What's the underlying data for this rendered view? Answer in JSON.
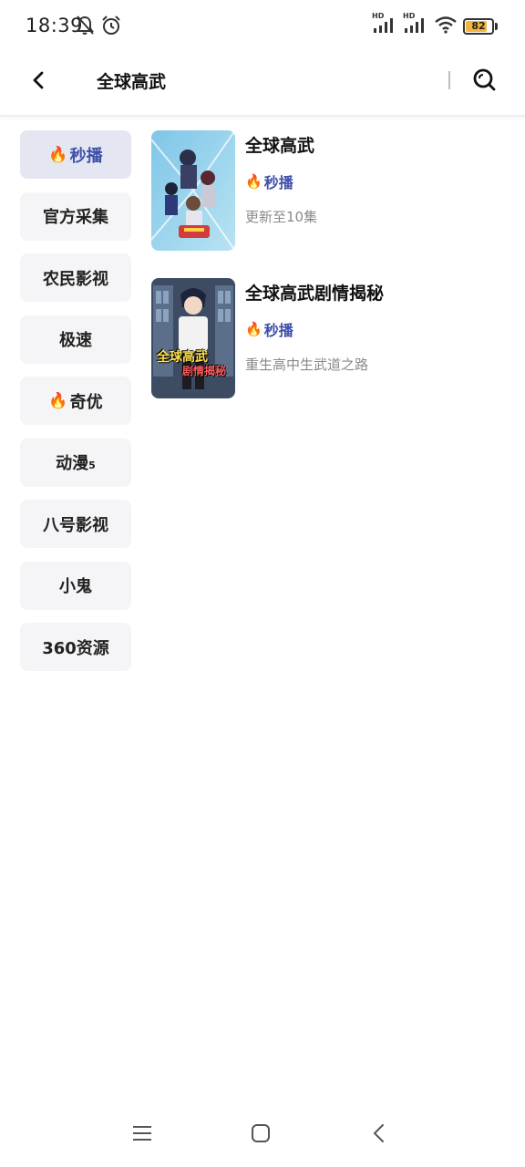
{
  "status_bar": {
    "time": "18:39",
    "battery_level": "82",
    "network_labels": [
      "HD",
      "HD"
    ],
    "icons": [
      "bell-off-icon",
      "alarm-icon",
      "signal-icon",
      "signal-icon",
      "wifi-icon",
      "battery-icon"
    ],
    "battery_color": "#f3b63a"
  },
  "header": {
    "title": "全球高武",
    "back_icon": "chevron-left-icon",
    "search_icon": "search-icon"
  },
  "sources": [
    {
      "label": "秒播",
      "hot": true,
      "active": true
    },
    {
      "label": "官方采集",
      "hot": false,
      "active": false
    },
    {
      "label": "农民影视",
      "hot": false,
      "active": false
    },
    {
      "label": "极速",
      "hot": false,
      "active": false
    },
    {
      "label": "奇优",
      "hot": true,
      "active": false
    },
    {
      "label": "动漫",
      "suffix": "5",
      "hot": false,
      "active": false
    },
    {
      "label": "八号影视",
      "hot": false,
      "active": false
    },
    {
      "label": "小鬼",
      "hot": false,
      "active": false
    },
    {
      "label": "360资源",
      "hot": false,
      "active": false
    }
  ],
  "results": [
    {
      "title": "全球高武",
      "source": "秒播",
      "desc": "更新至10集"
    },
    {
      "title": "全球高武剧情揭秘",
      "source": "秒播",
      "desc": "重生高中生武道之路",
      "poster_text_1": "全球高武",
      "poster_text_2": "剧情揭秘"
    }
  ],
  "colors": {
    "accent": "#3f4faa",
    "active_bg": "#e4e6f2",
    "item_bg": "#f5f5f7",
    "muted_text": "#8a8a8a"
  },
  "navbar": {
    "icons": [
      "menu-icon",
      "home-icon",
      "back-icon"
    ]
  }
}
